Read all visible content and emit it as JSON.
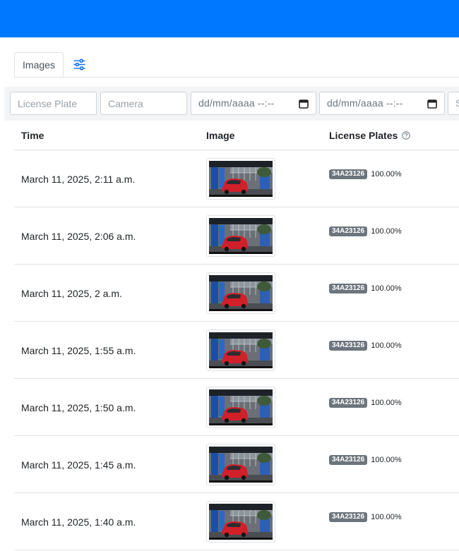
{
  "tabs": {
    "active_label": "Images",
    "settings_icon": "sliders-icon"
  },
  "filters": {
    "license_plate_placeholder": "License Plate",
    "camera_placeholder": "Camera",
    "date_from_placeholder": "dd/mm/aaaa --:--",
    "date_to_placeholder": "dd/mm/aaaa --:--",
    "next_placeholder_partial": "S"
  },
  "table": {
    "headers": {
      "time": "Time",
      "image": "Image",
      "license_plates": "License Plates"
    },
    "help_icon": "question-circle-icon",
    "rows": [
      {
        "time": "March 11, 2025, 2:11 a.m.",
        "plate": "34A23126",
        "confidence": "100.00%"
      },
      {
        "time": "March 11, 2025, 2:06 a.m.",
        "plate": "34A23126",
        "confidence": "100.00%"
      },
      {
        "time": "March 11, 2025, 2 a.m.",
        "plate": "34A23126",
        "confidence": "100.00%"
      },
      {
        "time": "March 11, 2025, 1:55 a.m.",
        "plate": "34A23126",
        "confidence": "100.00%"
      },
      {
        "time": "March 11, 2025, 1:50 a.m.",
        "plate": "34A23126",
        "confidence": "100.00%"
      },
      {
        "time": "March 11, 2025, 1:45 a.m.",
        "plate": "34A23126",
        "confidence": "100.00%"
      },
      {
        "time": "March 11, 2025, 1:40 a.m.",
        "plate": "34A23126",
        "confidence": "100.00%"
      }
    ]
  },
  "colors": {
    "header_bar": "#0078ff",
    "accent": "#0d6efd",
    "badge": "#6c757d",
    "car": "#d0202a"
  }
}
